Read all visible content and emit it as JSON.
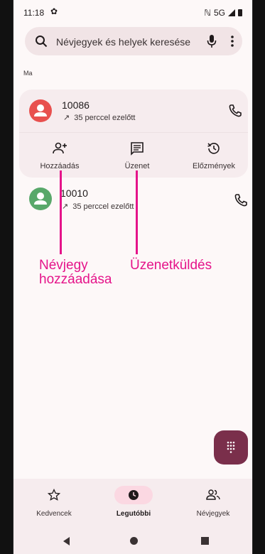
{
  "status_bar": {
    "time": "11:18",
    "gear": "✿",
    "nfc": "ℕ",
    "network": "5G"
  },
  "search": {
    "placeholder": "Névjegyek és helyek keresése"
  },
  "section": {
    "header": "Ma"
  },
  "calls": [
    {
      "number": "10086",
      "meta": "35 perccel ezelőtt",
      "arrow": "↗",
      "avatar_color": "#e8504e"
    },
    {
      "number": "10010",
      "meta": "35 perccel ezelőtt",
      "arrow": "↗",
      "avatar_color": "#58a86a"
    }
  ],
  "actions": [
    {
      "label": "Hozzáadás",
      "icon": "add-contact-icon"
    },
    {
      "label": "Üzenet",
      "icon": "message-icon"
    },
    {
      "label": "Előzmények",
      "icon": "history-icon"
    }
  ],
  "annotations": {
    "add_contact_line1": "Névjegy",
    "add_contact_line2": "hozzáadása",
    "messaging": "Üzenetküldés",
    "color": "#e5148a"
  },
  "bottom_nav": [
    {
      "label": "Kedvencek",
      "icon": "star-icon",
      "active": false
    },
    {
      "label": "Legutóbbi",
      "icon": "clock-icon",
      "active": true
    },
    {
      "label": "Névjegyek",
      "icon": "contacts-icon",
      "active": false
    }
  ],
  "colors": {
    "fab": "#7a2f4b",
    "active_nav_pill": "#fbd8e2",
    "card": "#f6ecee"
  }
}
